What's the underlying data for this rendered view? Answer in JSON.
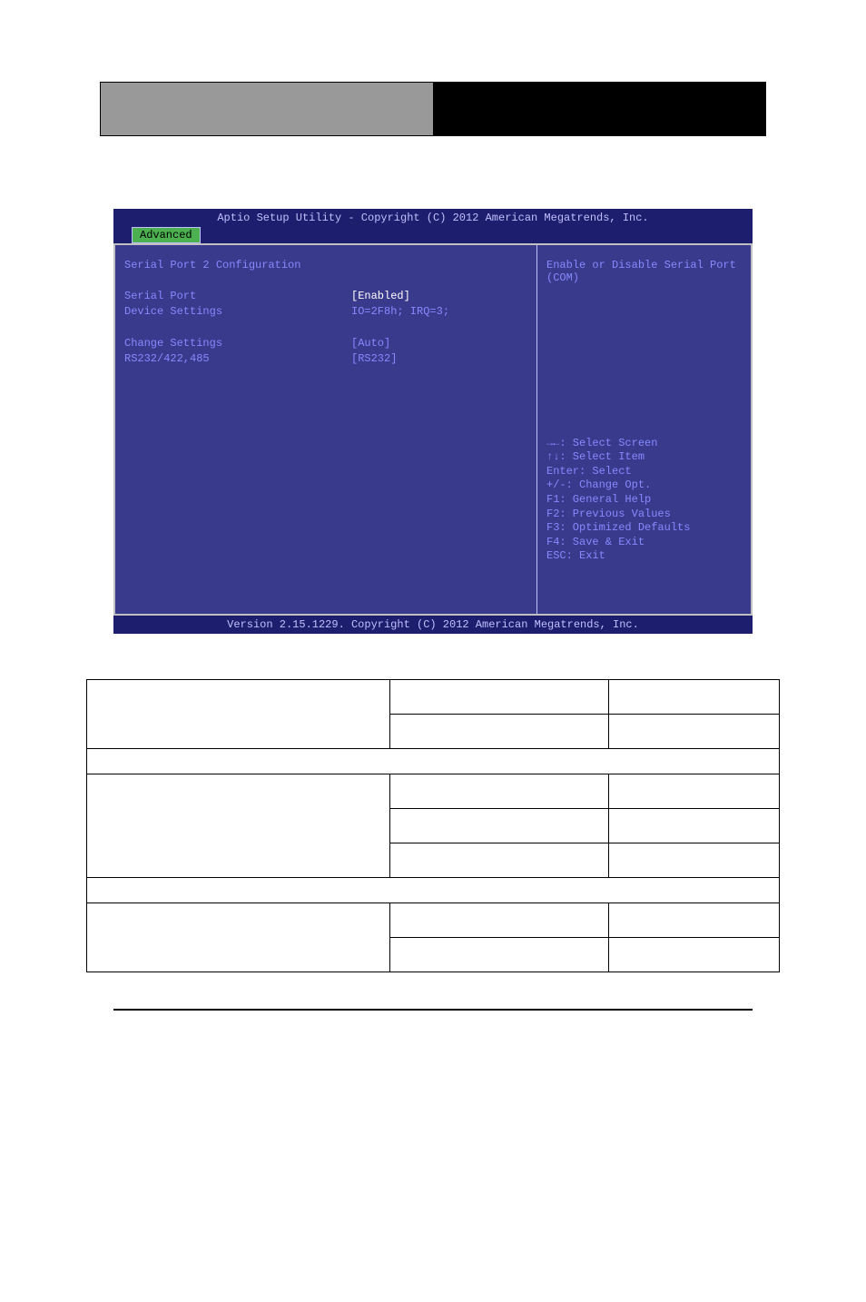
{
  "bios": {
    "title": "Aptio Setup Utility - Copyright (C) 2012 American Megatrends, Inc.",
    "tab": "Advanced",
    "section_title": "Serial Port 2 Configuration",
    "rows": [
      {
        "label": "Serial Port",
        "value": "[Enabled]",
        "highlighted": true
      },
      {
        "label": "Device Settings",
        "value": "IO=2F8h; IRQ=3;",
        "highlighted": false
      }
    ],
    "rows2": [
      {
        "label": "Change Settings",
        "value": "[Auto]",
        "highlighted": false
      },
      {
        "label": "RS232/422,485",
        "value": "[RS232]",
        "highlighted": false
      }
    ],
    "help_line1": "Enable or Disable Serial Port",
    "help_line2": "(COM)",
    "nav": {
      "n1": "→←: Select Screen",
      "n2": "↑↓: Select Item",
      "n3": "Enter: Select",
      "n4": "+/-: Change Opt.",
      "n5": "F1: General Help",
      "n6": "F2: Previous Values",
      "n7": "F3: Optimized Defaults",
      "n8": "F4: Save & Exit",
      "n9": "ESC: Exit"
    },
    "footer": "Version 2.15.1229. Copyright (C) 2012 American Megatrends, Inc."
  }
}
